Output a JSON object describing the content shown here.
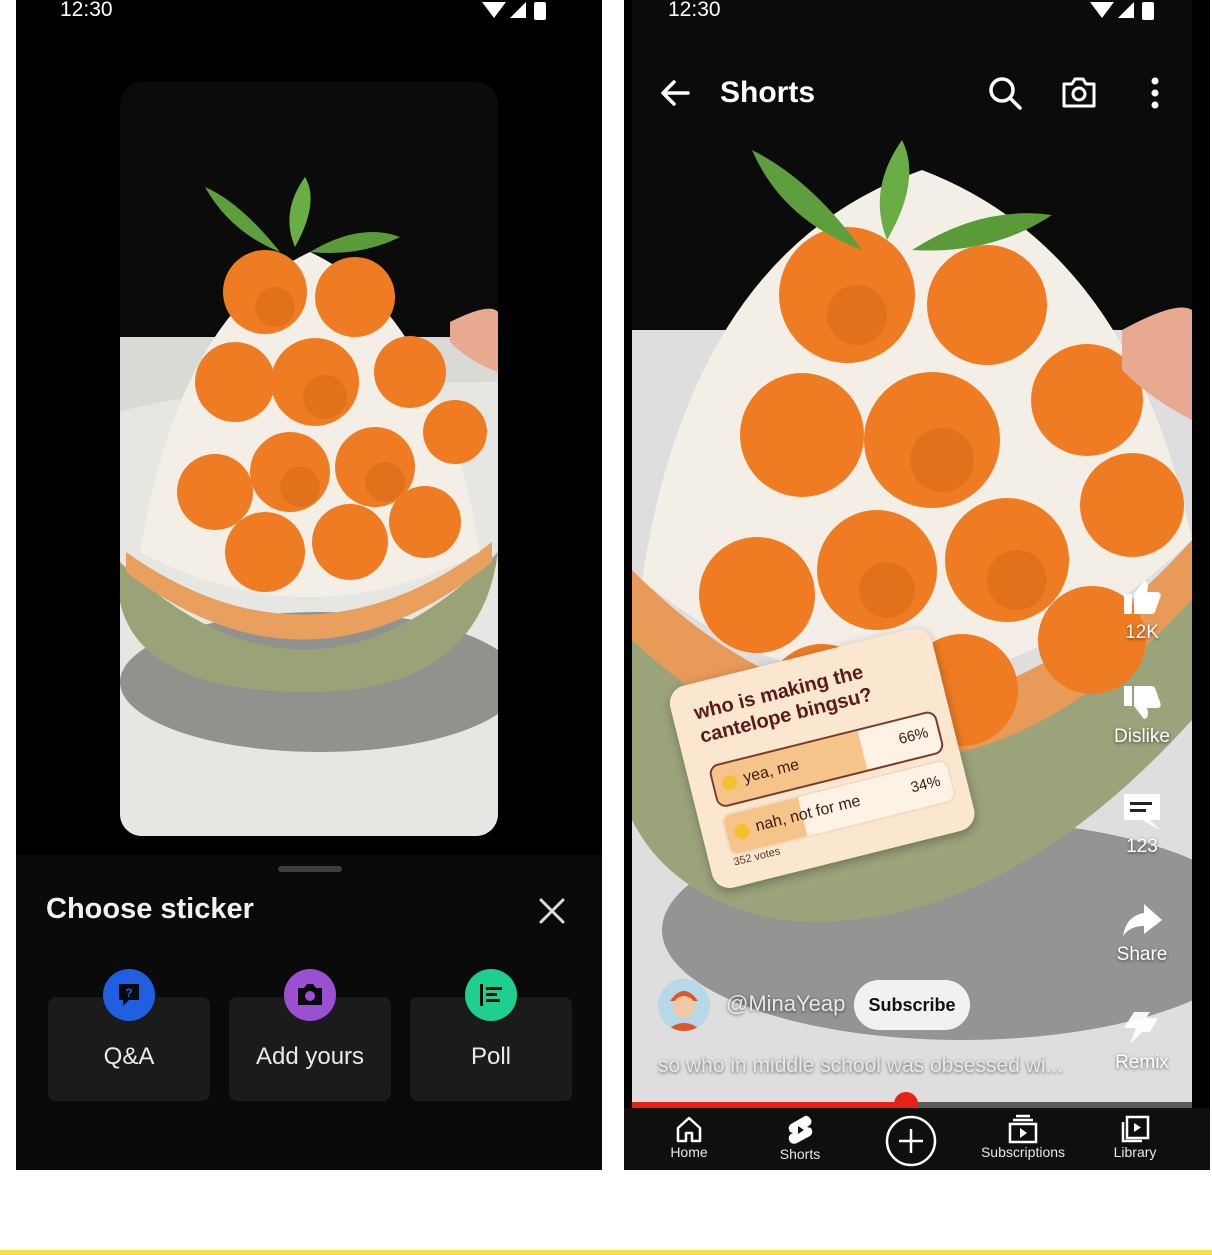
{
  "status_bar": {
    "time": "12:30"
  },
  "left_screen": {
    "sheet": {
      "title": "Choose sticker",
      "stickers": [
        {
          "label": "Q&A",
          "icon": "qa-icon",
          "color": "#1f5fe0"
        },
        {
          "label": "Add yours",
          "icon": "camera-icon",
          "color": "#9b4fd3"
        },
        {
          "label": "Poll",
          "icon": "poll-icon",
          "color": "#1fcf8f"
        }
      ]
    }
  },
  "right_screen": {
    "header": {
      "title": "Shorts"
    },
    "rail": {
      "like_count": "12K",
      "dislike_label": "Dislike",
      "comment_count": "123",
      "share_label": "Share",
      "remix_label": "Remix"
    },
    "poll": {
      "question": "who is making the cantelope bingsu?",
      "options": [
        {
          "label": "yea, me",
          "percent": "66%",
          "fraction": 0.66
        },
        {
          "label": "nah, not for me",
          "percent": "34%",
          "fraction": 0.34
        }
      ],
      "votes": "352 votes"
    },
    "channel": {
      "handle": "@MinaYeap",
      "subscribe_label": "Subscribe"
    },
    "caption": "so who in middle school was obsessed wi...",
    "progress": {
      "fraction": 0.49
    },
    "nav": {
      "items": [
        {
          "label": "Home",
          "icon": "home-icon"
        },
        {
          "label": "Shorts",
          "icon": "shorts-icon"
        },
        {
          "label": "Subscriptions",
          "icon": "subscriptions-icon"
        },
        {
          "label": "Library",
          "icon": "library-icon"
        }
      ]
    }
  },
  "colors": {
    "accent_red": "#e62117",
    "sheet_bg": "#0a0a0a",
    "poll_bg": "#fbe6cf"
  }
}
